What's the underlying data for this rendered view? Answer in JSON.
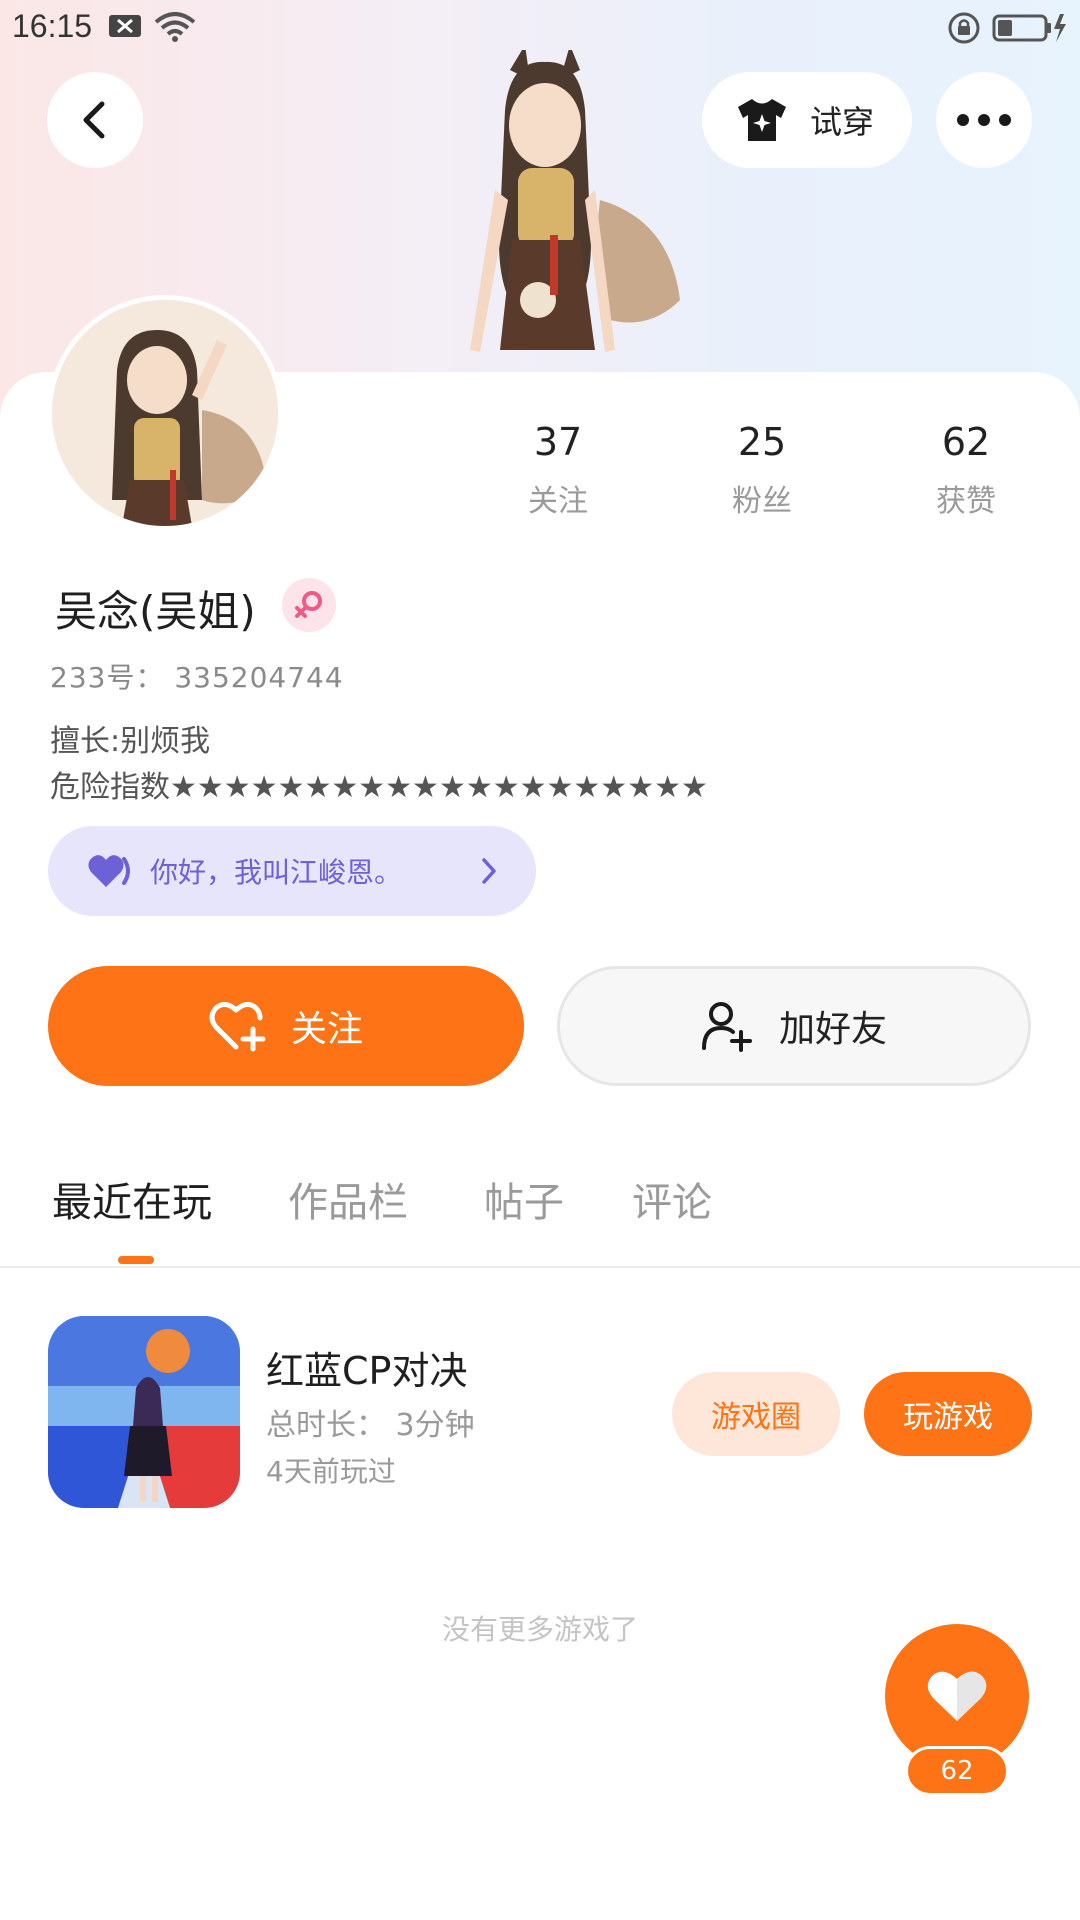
{
  "status_bar": {
    "time": "16:15"
  },
  "header": {
    "try_on_label": "试穿"
  },
  "stats": [
    {
      "value": "37",
      "label": "关注"
    },
    {
      "value": "25",
      "label": "粉丝"
    },
    {
      "value": "62",
      "label": "获赞"
    }
  ],
  "profile": {
    "nickname": "吴念(吴姐)",
    "uid_line": "233号： 335204744",
    "bio_line1": "擅长:别烦我",
    "bio_line2": "危险指数★★★★★★★★★★★★★★★★★★★★"
  },
  "greeting": {
    "text": "你好，我叫江峻恩。"
  },
  "actions": {
    "follow_label": "关注",
    "add_friend_label": "加好友"
  },
  "tabs": [
    {
      "label": "最近在玩"
    },
    {
      "label": "作品栏"
    },
    {
      "label": "帖子"
    },
    {
      "label": "评论"
    }
  ],
  "games": [
    {
      "name": "红蓝CP对决",
      "duration": "总时长： 3分钟",
      "last_played": "4天前玩过",
      "circle_label": "游戏圈",
      "play_label": "玩游戏"
    }
  ],
  "footer": {
    "no_more": "没有更多游戏了"
  },
  "like_fab": {
    "count": "62"
  },
  "colors": {
    "accent": "#fe7316",
    "greeting_bg": "#e7e5fb",
    "greeting_text": "#6d61d8",
    "gender": "#f05a86"
  }
}
